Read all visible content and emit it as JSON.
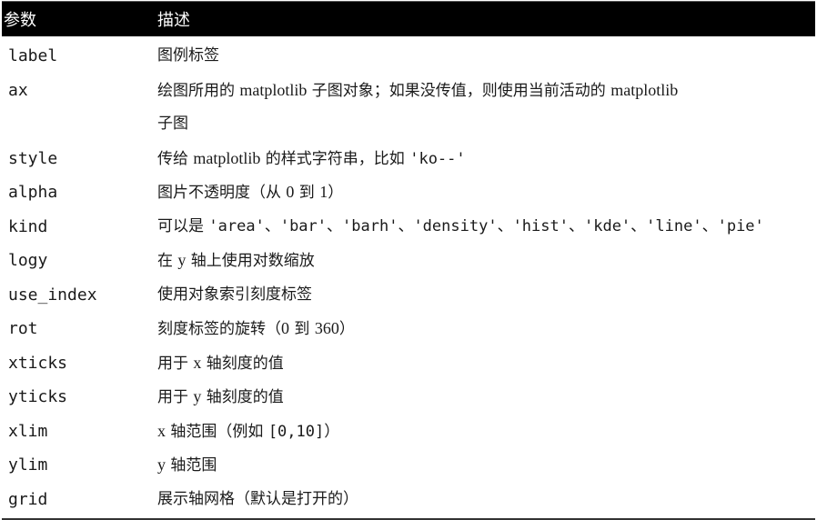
{
  "table": {
    "headers": {
      "param": "参数",
      "description": "描述"
    },
    "rows": [
      {
        "param": "label",
        "description": [
          [
            "text",
            "图例标签"
          ]
        ]
      },
      {
        "param": "ax",
        "description": [
          [
            "text",
            "绘图所用的 "
          ],
          [
            "serif",
            "matplotlib"
          ],
          [
            "text",
            " 子图对象；如果没传值，则使用当前活动的 "
          ],
          [
            "serif",
            "matplotlib"
          ]
        ],
        "continuation": "子图"
      },
      {
        "param": "style",
        "description": [
          [
            "text",
            "传给 "
          ],
          [
            "serif",
            "matplotlib"
          ],
          [
            "text",
            " 的样式字符串，比如 "
          ],
          [
            "mono",
            "'ko--'"
          ]
        ]
      },
      {
        "param": "alpha",
        "description": [
          [
            "text",
            "图片不透明度（从 "
          ],
          [
            "serif",
            "0"
          ],
          [
            "text",
            " 到 "
          ],
          [
            "serif",
            "1"
          ],
          [
            "text",
            "）"
          ]
        ]
      },
      {
        "param": "kind",
        "description": [
          [
            "text",
            "可以是 "
          ],
          [
            "mono",
            "'area'"
          ],
          [
            "text",
            "、"
          ],
          [
            "mono",
            "'bar'"
          ],
          [
            "text",
            "、"
          ],
          [
            "mono",
            "'barh'"
          ],
          [
            "text",
            "、"
          ],
          [
            "mono",
            "'density'"
          ],
          [
            "text",
            "、"
          ],
          [
            "mono",
            "'hist'"
          ],
          [
            "text",
            "、"
          ],
          [
            "mono",
            "'kde'"
          ],
          [
            "text",
            "、"
          ],
          [
            "mono",
            "'line'"
          ],
          [
            "text",
            "、"
          ],
          [
            "mono",
            "'pie'"
          ]
        ]
      },
      {
        "param": "logy",
        "description": [
          [
            "text",
            "在 "
          ],
          [
            "serif",
            "y"
          ],
          [
            "text",
            " 轴上使用对数缩放"
          ]
        ]
      },
      {
        "param": "use_index",
        "description": [
          [
            "text",
            "使用对象索引刻度标签"
          ]
        ]
      },
      {
        "param": "rot",
        "description": [
          [
            "text",
            "刻度标签的旋转（"
          ],
          [
            "serif",
            "0"
          ],
          [
            "text",
            " 到 "
          ],
          [
            "serif",
            "360"
          ],
          [
            "text",
            "）"
          ]
        ]
      },
      {
        "param": "xticks",
        "description": [
          [
            "text",
            "用于 "
          ],
          [
            "serif",
            "x"
          ],
          [
            "text",
            " 轴刻度的值"
          ]
        ]
      },
      {
        "param": "yticks",
        "description": [
          [
            "text",
            "用于 "
          ],
          [
            "serif",
            "y"
          ],
          [
            "text",
            " 轴刻度的值"
          ]
        ]
      },
      {
        "param": "xlim",
        "description": [
          [
            "serif",
            "x"
          ],
          [
            "text",
            " 轴范围（例如 "
          ],
          [
            "mono",
            "[0,10]"
          ],
          [
            "text",
            "）"
          ]
        ]
      },
      {
        "param": "ylim",
        "description": [
          [
            "serif",
            "y"
          ],
          [
            "text",
            " 轴范围"
          ]
        ]
      },
      {
        "param": "grid",
        "description": [
          [
            "text",
            "展示轴网格（默认是打开的）"
          ]
        ]
      }
    ]
  }
}
